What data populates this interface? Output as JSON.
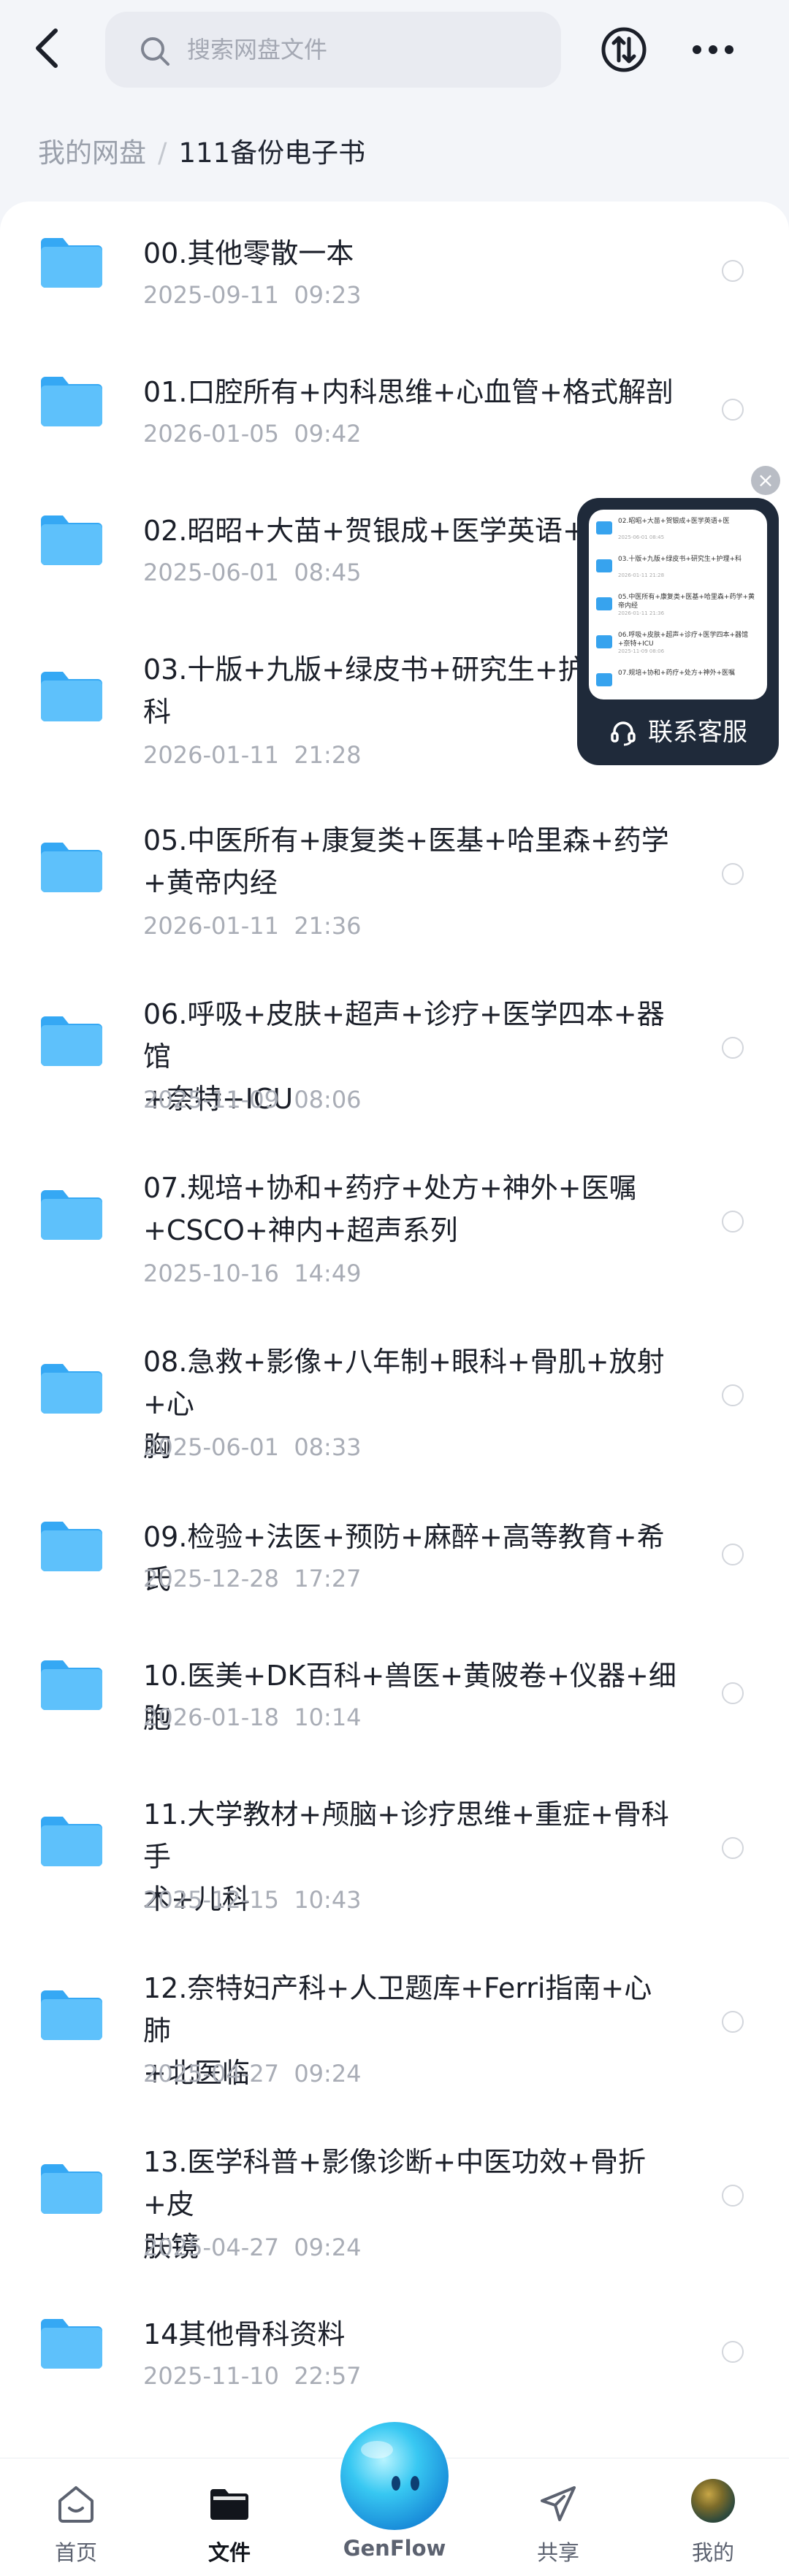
{
  "search": {
    "placeholder": "搜索网盘文件"
  },
  "breadcrumb": {
    "root": "我的网盘",
    "separator": "/",
    "current": "111备份电子书"
  },
  "files": [
    {
      "name": "00.其他零散一本",
      "date": "2025-09-11  09:23"
    },
    {
      "name": "01.口腔所有+内科思维+心血管+格式解剖",
      "date": "2026-01-05  09:42"
    },
    {
      "name": "02.昭昭+大苗+贺银成+医学英语+医",
      "date": "2025-06-01  08:45"
    },
    {
      "name": "03.十版+九版+绿皮书+研究生+护理",
      "name2": "科",
      "date": "2026-01-11  21:28"
    },
    {
      "name": "05.中医所有+康复类+医基+哈里森+药学",
      "name2": "+黄帝内经",
      "date": "2026-01-11  21:36"
    },
    {
      "name": "06.呼吸+皮肤+超声+诊疗+医学四本+器馆",
      "name2": "+奈特+ICU",
      "date": "2025-11-09  08:06"
    },
    {
      "name": "07.规培+协和+药疗+处方+神外+医嘱",
      "name2": "+CSCO+神内+超声系列",
      "date": "2025-10-16  14:49"
    },
    {
      "name": "08.急救+影像+八年制+眼科+骨肌+放射+心",
      "name2": "胸",
      "date": "2025-06-01  08:33"
    },
    {
      "name": "09.检验+法医+预防+麻醉+高等教育+希氏",
      "date": "2025-12-28  17:27"
    },
    {
      "name": "10.医美+DK百科+兽医+黄陂卷+仪器+细胞",
      "date": "2026-01-18  10:14"
    },
    {
      "name": "11.大学教材+颅脑+诊疗思维+重症+骨科手",
      "name2": "术+儿科",
      "date": "2025-12-15  10:43"
    },
    {
      "name": "12.奈特妇产科+人卫题库+Ferri指南+心肺",
      "name2": "+北医临",
      "date": "2025-04-27  09:24"
    },
    {
      "name": "13.医学科普+影像诊断+中医功效+骨折+皮",
      "name2": "肤镜",
      "date": "2025-04-27  09:24"
    },
    {
      "name": "14其他骨科资料",
      "date": "2025-11-10  22:57"
    }
  ],
  "float_service": {
    "label": "联系客服",
    "close": "×",
    "preview": [
      {
        "title": "02.昭昭+大苗+贺银成+医学英语+医",
        "date": "2025-06-01 08:45"
      },
      {
        "title": "03.十版+九版+绿皮书+研究生+护理+科",
        "date": "2026-01-11 21:28"
      },
      {
        "title": "05.中医所有+康复类+医基+哈里森+药学+黄帝内经",
        "date": "2026-01-11 21:36"
      },
      {
        "title": "06.呼吸+皮肤+超声+诊疗+医学四本+器馆+奈特+ICU",
        "date": "2025-11-09 08:06"
      },
      {
        "title": "07.规培+协和+药疗+处方+神外+医嘱",
        "date": ""
      }
    ]
  },
  "bottom_nav": {
    "home": "首页",
    "files": "文件",
    "genflow": "GenFlow",
    "share": "共享",
    "mine": "我的"
  },
  "colors": {
    "accent": "#2b9ef0",
    "folder": "#48b4f7",
    "text": "#1b1f29",
    "muted": "#a9adb6"
  }
}
